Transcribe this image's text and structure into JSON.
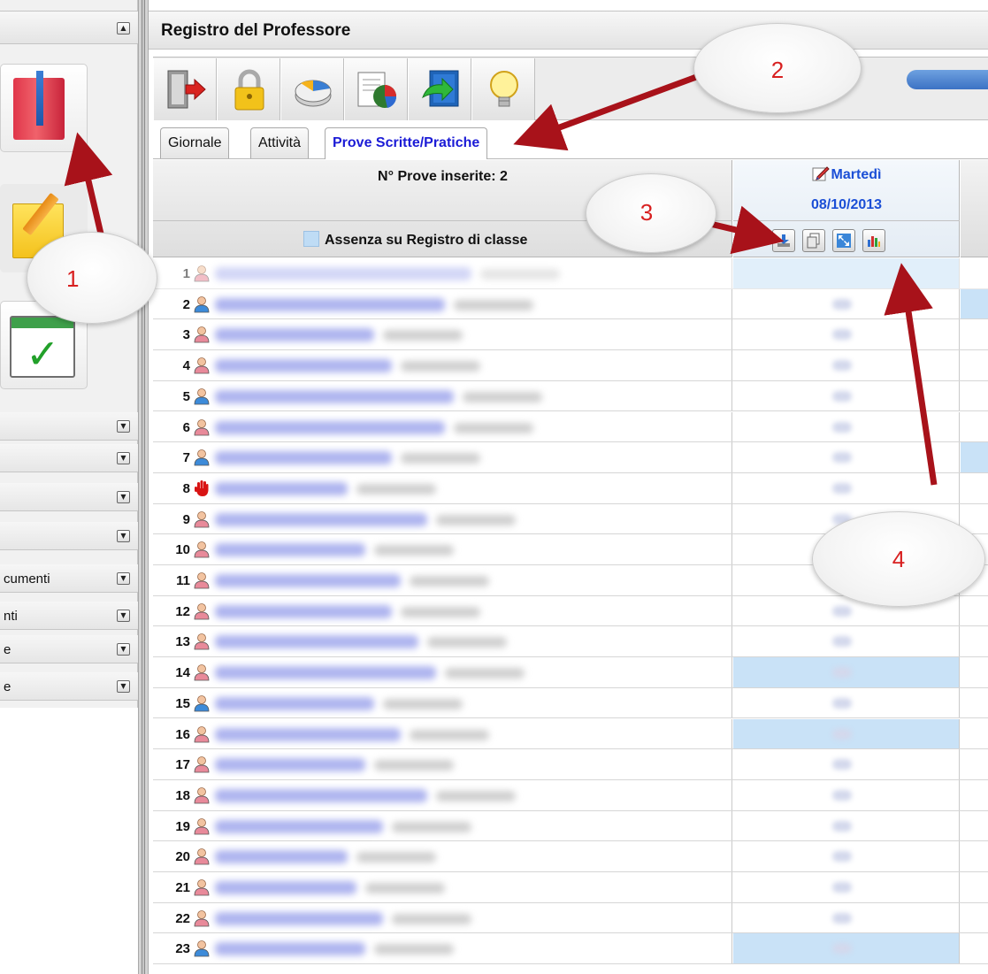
{
  "sidebar": {
    "rows": [
      {
        "label": ""
      },
      {
        "label": ""
      },
      {
        "label": ""
      },
      {
        "label": ""
      },
      {
        "label": "cumenti"
      },
      {
        "label": "nti"
      },
      {
        "label": "e"
      },
      {
        "label": "e"
      }
    ],
    "collapse_glyph_up": "▲",
    "collapse_glyph_down": "▼"
  },
  "main": {
    "title": "Registro del Professore"
  },
  "tabs": [
    {
      "label": "Giornale"
    },
    {
      "label": "Attività"
    },
    {
      "label": "Prove Scritte/Pratiche"
    }
  ],
  "grid": {
    "count_label": "N° Prove inserite: 2",
    "absence_label": "Assenza su Registro di classe",
    "day": "Martedì",
    "date": "08/10/2013"
  },
  "students": [
    {
      "num": "1",
      "gender": "f",
      "absent": true
    },
    {
      "num": "2",
      "gender": "m",
      "absent": false
    },
    {
      "num": "3",
      "gender": "f",
      "absent": false
    },
    {
      "num": "4",
      "gender": "f",
      "absent": false
    },
    {
      "num": "5",
      "gender": "m",
      "absent": false
    },
    {
      "num": "6",
      "gender": "f",
      "absent": false
    },
    {
      "num": "7",
      "gender": "m",
      "absent": false
    },
    {
      "num": "8",
      "gender": "hand",
      "absent": false
    },
    {
      "num": "9",
      "gender": "f",
      "absent": false
    },
    {
      "num": "10",
      "gender": "f",
      "absent": false
    },
    {
      "num": "11",
      "gender": "f",
      "absent": false
    },
    {
      "num": "12",
      "gender": "f",
      "absent": false
    },
    {
      "num": "13",
      "gender": "f",
      "absent": false
    },
    {
      "num": "14",
      "gender": "f",
      "absent": true
    },
    {
      "num": "15",
      "gender": "m",
      "absent": false
    },
    {
      "num": "16",
      "gender": "f",
      "absent": true
    },
    {
      "num": "17",
      "gender": "f",
      "absent": false
    },
    {
      "num": "18",
      "gender": "f",
      "absent": false
    },
    {
      "num": "19",
      "gender": "f",
      "absent": false
    },
    {
      "num": "20",
      "gender": "f",
      "absent": false
    },
    {
      "num": "21",
      "gender": "f",
      "absent": false
    },
    {
      "num": "22",
      "gender": "f",
      "absent": false
    },
    {
      "num": "23",
      "gender": "m",
      "absent": true
    }
  ],
  "callouts": [
    {
      "label": "1"
    },
    {
      "label": "2"
    },
    {
      "label": "3"
    },
    {
      "label": "4"
    }
  ],
  "colors": {
    "accent_blue": "#1b4fd6",
    "absent_fill": "#c9e2f7",
    "arrow_red": "#a8121a",
    "callout_text": "#d82020"
  },
  "icons": {
    "toolbar": [
      "exit-door-icon",
      "lock-icon",
      "pie-chart-icon",
      "report-chart-icon",
      "export-icon",
      "lightbulb-icon"
    ],
    "actions": [
      "download-icon",
      "copy-icon",
      "expand-icon",
      "bar-chart-icon"
    ],
    "sidebar": [
      "register-book-icon",
      "notepad-pencil-icon",
      "calendar-check-icon"
    ]
  }
}
